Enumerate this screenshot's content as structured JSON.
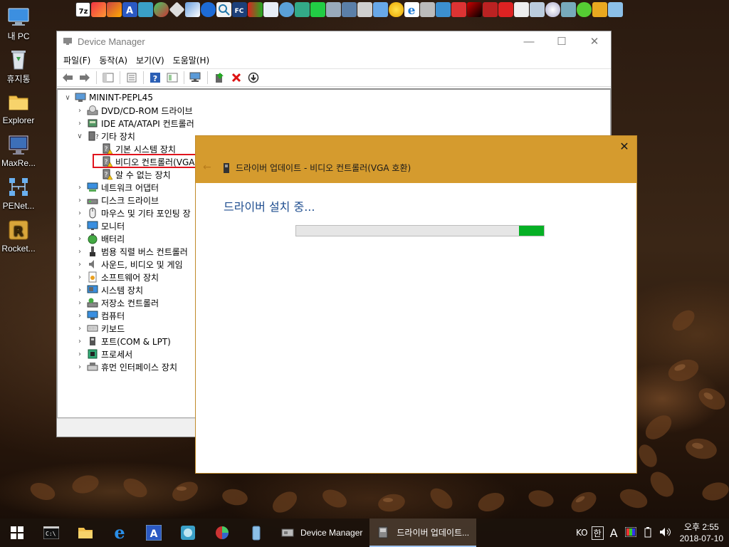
{
  "desktop": {
    "icons": [
      {
        "label": "내 PC",
        "icon": "my-pc-icon"
      },
      {
        "label": "휴지통",
        "icon": "recycle-bin-icon"
      },
      {
        "label": "Explorer",
        "icon": "explorer-folder-icon"
      },
      {
        "label": "MaxRe...",
        "icon": "maxre-monitor-icon"
      },
      {
        "label": "PENet...",
        "icon": "penet-network-icon"
      },
      {
        "label": "Rocket...",
        "icon": "rocket-r-icon"
      }
    ]
  },
  "device_manager": {
    "title": "Device Manager",
    "menu": [
      "파일(F)",
      "동작(A)",
      "보기(V)",
      "도움말(H)"
    ],
    "tree": {
      "root": "MININT-PEPL45",
      "items": [
        {
          "label": "DVD/CD-ROM 드라이브",
          "icon": "dvd-drive-icon"
        },
        {
          "label": "IDE ATA/ATAPI 컨트롤러",
          "icon": "ide-controller-icon"
        },
        {
          "label": "기타 장치",
          "icon": "other-devices-icon",
          "expanded": true
        },
        {
          "label": "기본 시스템 장치",
          "icon": "unknown-device-warning-icon"
        },
        {
          "label": "비디오 컨트롤러(VGA",
          "icon": "unknown-device-warning-icon",
          "highlighted": true
        },
        {
          "label": "알 수 없는 장치",
          "icon": "unknown-device-warning-icon"
        },
        {
          "label": "네트워크 어댑터",
          "icon": "network-adapter-icon"
        },
        {
          "label": "디스크 드라이브",
          "icon": "disk-drive-icon"
        },
        {
          "label": "마우스 및 기타 포인팅 장",
          "icon": "mouse-icon"
        },
        {
          "label": "모니터",
          "icon": "monitor-icon"
        },
        {
          "label": "배터리",
          "icon": "battery-icon"
        },
        {
          "label": "범용 직렬 버스 컨트롤러",
          "icon": "usb-icon"
        },
        {
          "label": "사운드, 비디오 및 게임 ",
          "icon": "sound-icon"
        },
        {
          "label": "소프트웨어 장치",
          "icon": "software-device-icon"
        },
        {
          "label": "시스템 장치",
          "icon": "system-device-icon"
        },
        {
          "label": "저장소 컨트롤러",
          "icon": "storage-controller-icon"
        },
        {
          "label": "컴퓨터",
          "icon": "computer-icon"
        },
        {
          "label": "키보드",
          "icon": "keyboard-icon"
        },
        {
          "label": "포트(COM & LPT)",
          "icon": "port-icon"
        },
        {
          "label": "프로세서",
          "icon": "processor-icon"
        },
        {
          "label": "휴먼 인터페이스 장치",
          "icon": "hid-icon"
        }
      ]
    }
  },
  "update_driver": {
    "title": "드라이버 업데이트 - 비디오 컨트롤러(VGA 호환)",
    "status": "드라이버 설치 중...",
    "progress": 0.1
  },
  "taskbar": {
    "tasks": [
      {
        "label": "Device Manager",
        "active": false
      },
      {
        "label": "드라이버 업데이트...",
        "active": true
      }
    ],
    "tray": {
      "lang": "KO",
      "ime": "한",
      "ime_mode": "A"
    },
    "clock": {
      "time": "오후 2:55",
      "date": "2018-07-10"
    }
  },
  "colors": {
    "dialog_header": "#d59b2e",
    "progress_fill": "#06b025",
    "status_text": "#1e4d8f",
    "highlight_box": "#e0141e"
  }
}
